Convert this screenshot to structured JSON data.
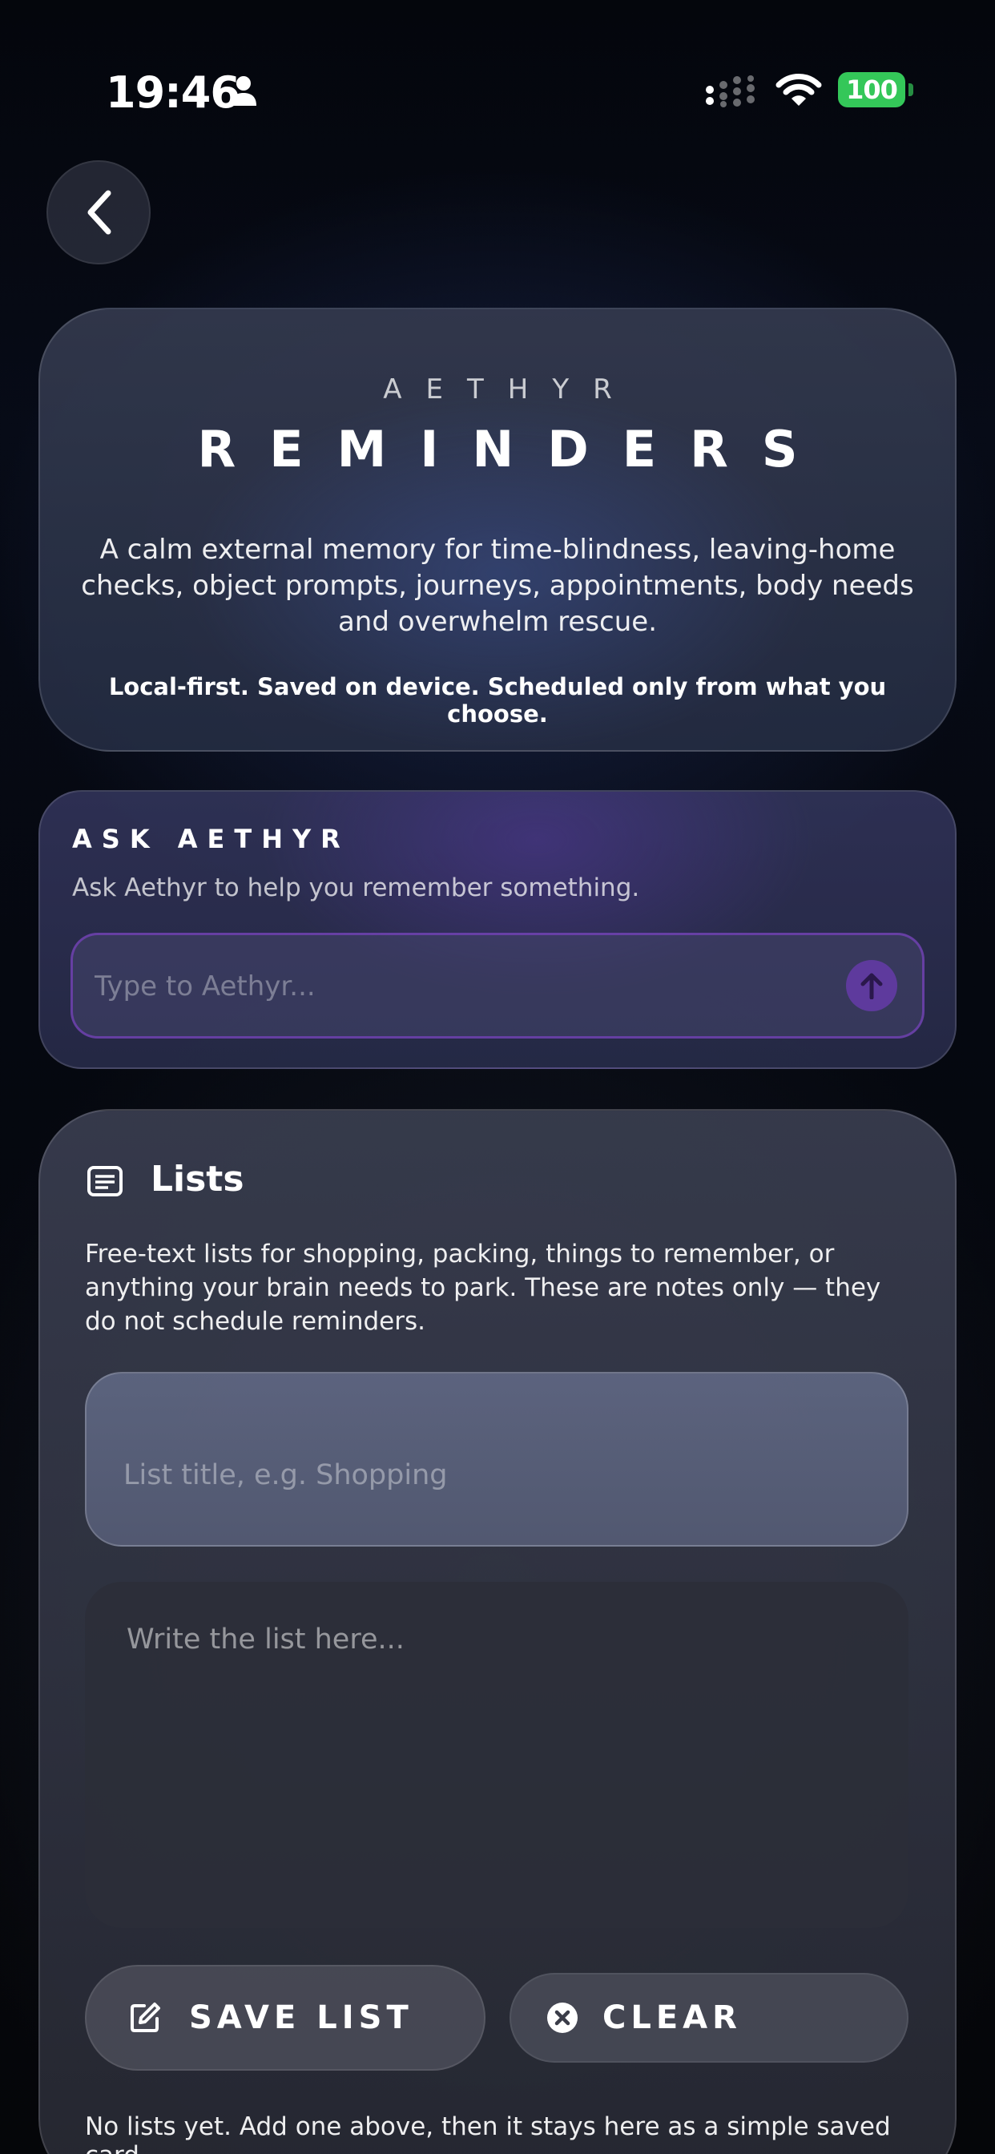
{
  "status_bar": {
    "time": "19:46",
    "battery": "100",
    "icons": [
      "person-icon",
      "cellular-signal-icon",
      "wifi-icon",
      "battery-icon"
    ]
  },
  "nav": {
    "back_icon": "chevron-left-icon"
  },
  "hero": {
    "brand": "AETHYR",
    "title": "REMINDERS",
    "description": "A calm external memory for time-blindness, leaving-home checks, object prompts, journeys, appointments, body needs and overwhelm rescue.",
    "note": "Local-first. Saved on device. Scheduled only from what you choose."
  },
  "ask": {
    "title": "ASK AETHYR",
    "subtitle": "Ask Aethyr to help you remember something.",
    "input_placeholder": "Type to Aethyr...",
    "input_value": "",
    "send_icon": "arrow-up-icon"
  },
  "lists": {
    "icon": "list-icon",
    "title": "Lists",
    "description": "Free-text lists for shopping, packing, things to remember, or anything your brain needs to park. These are notes only — they do not schedule reminders.",
    "title_placeholder": "List title, e.g. Shopping",
    "title_value": "",
    "body_placeholder": "Write the list here...",
    "body_value": "",
    "save_label": "SAVE LIST",
    "save_icon": "edit-icon",
    "clear_label": "CLEAR",
    "clear_icon": "close-circle-icon",
    "empty_text": "No lists yet. Add one above, then it stays here as a simple saved card."
  },
  "colors": {
    "battery": "#34c759",
    "accent": "#8c46dc",
    "background": "#050810"
  }
}
